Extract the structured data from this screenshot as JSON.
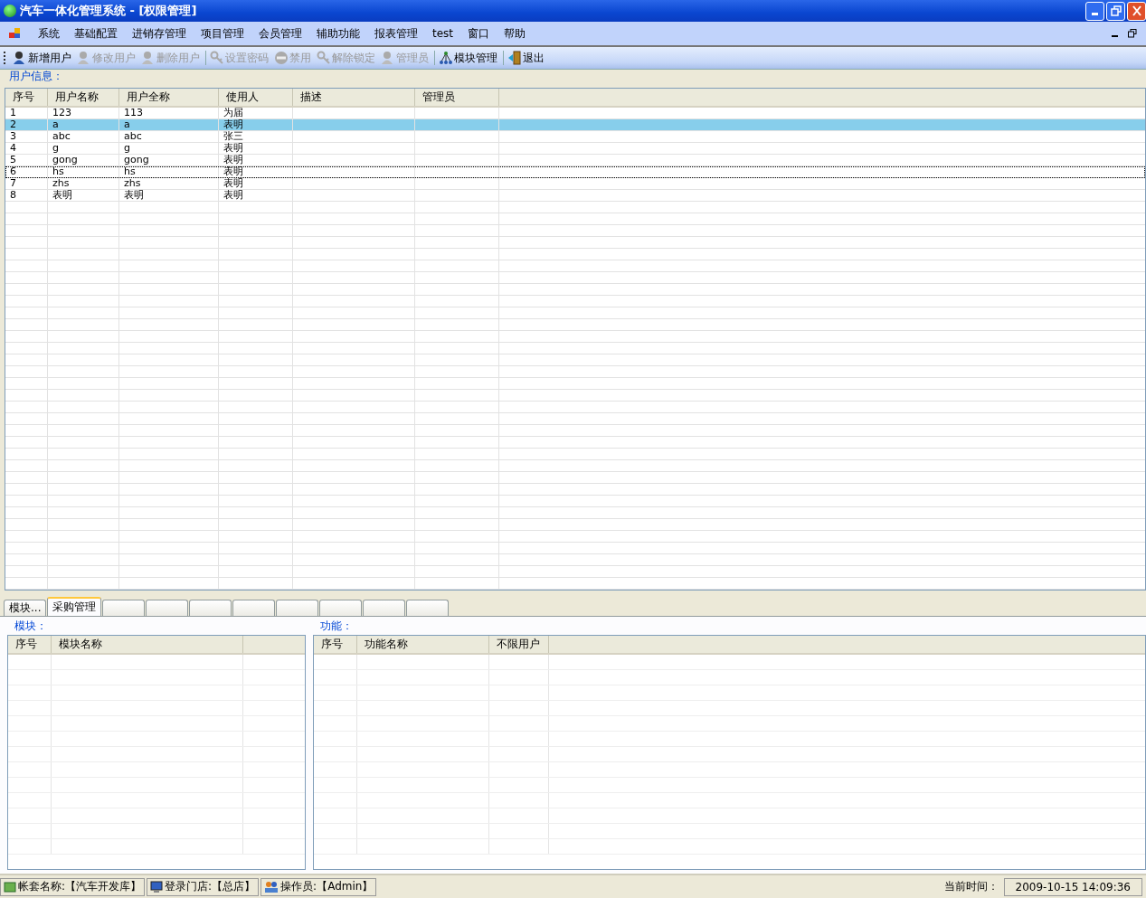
{
  "window": {
    "title": "汽车一体化管理系统 - [权限管理]"
  },
  "menu": [
    "系统",
    "基础配置",
    "进销存管理",
    "项目管理",
    "会员管理",
    "辅助功能",
    "报表管理",
    "test",
    "窗口",
    "帮助"
  ],
  "toolbar": [
    {
      "label": "新增用户",
      "disabled": false,
      "kind": "user"
    },
    {
      "label": "修改用户",
      "disabled": true,
      "kind": "user"
    },
    {
      "label": "删除用户",
      "disabled": true,
      "kind": "user"
    },
    {
      "label": "设置密码",
      "disabled": true,
      "kind": "key"
    },
    {
      "label": "禁用",
      "disabled": true,
      "kind": "ban"
    },
    {
      "label": "解除锁定",
      "disabled": true,
      "kind": "key"
    },
    {
      "label": "管理员",
      "disabled": true,
      "kind": "user"
    },
    {
      "label": "模块管理",
      "disabled": false,
      "kind": "tree"
    },
    {
      "label": "退出",
      "disabled": false,
      "kind": "exit"
    }
  ],
  "user_group": {
    "title": "用户信息：",
    "columns": [
      "序号",
      "用户名称",
      "用户全称",
      "使用人",
      "描述",
      "管理员"
    ],
    "rows": [
      {
        "cells": [
          "1",
          "123",
          "113",
          "为届"
        ],
        "selected": false,
        "focused": false
      },
      {
        "cells": [
          "2",
          "a",
          "a",
          "表明"
        ],
        "selected": true,
        "focused": false
      },
      {
        "cells": [
          "3",
          "abc",
          "abc",
          "张三"
        ],
        "selected": false,
        "focused": false
      },
      {
        "cells": [
          "4",
          "g",
          "g",
          "表明"
        ],
        "selected": false,
        "focused": false
      },
      {
        "cells": [
          "5",
          "gong",
          "gong",
          "表明"
        ],
        "selected": false,
        "focused": false
      },
      {
        "cells": [
          "6",
          "hs",
          "hs",
          "表明"
        ],
        "selected": false,
        "focused": true
      },
      {
        "cells": [
          "7",
          "zhs",
          "zhs",
          "表明"
        ],
        "selected": false,
        "focused": false
      },
      {
        "cells": [
          "8",
          "表明",
          "表明",
          "表明"
        ],
        "selected": false,
        "focused": false
      }
    ]
  },
  "tabs": [
    {
      "label": "模块...",
      "selected": false
    },
    {
      "label": "采购管理",
      "selected": true
    }
  ],
  "module_group": {
    "title": "模块：",
    "columns": [
      "序号",
      "模块名称"
    ]
  },
  "function_group": {
    "title": "功能：",
    "columns": [
      "序号",
      "功能名称",
      "不限用户"
    ]
  },
  "status_bar": {
    "account": "帐套名称:【汽车开发库】",
    "store": "登录门店:【总店】",
    "operator": "操作员:【Admin】",
    "time_label": "当前时间：",
    "time": "2009-10-15 14:09:36"
  }
}
